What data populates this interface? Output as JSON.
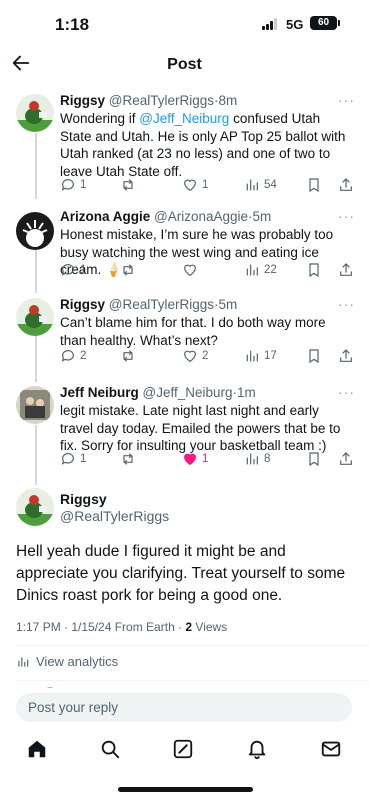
{
  "status_bar": {
    "time": "1:18",
    "network": "5G",
    "battery": "60"
  },
  "header": {
    "title": "Post"
  },
  "tweets": [
    {
      "name": "Riggsy",
      "handle": "@RealTylerRiggs",
      "time": "8m",
      "text_before": "Wondering if ",
      "mention": "@Jeff_Neiburg",
      "text_after": " confused Utah State and Utah. He is only AP Top 25 ballot with Utah ranked (at 23 no less) and one of two to leave Utah State off.",
      "replies": "1",
      "retweets": "",
      "likes": "1",
      "views": "54",
      "liked": false
    },
    {
      "name": "Arizona Aggie",
      "handle": "@ArizonaAggie",
      "time": "5m",
      "text": "Honest mistake, I’m sure he was probably too busy watching the west wing and eating ice cream. 🍦",
      "replies": "1",
      "retweets": "",
      "likes": "",
      "views": "22",
      "liked": false
    },
    {
      "name": "Riggsy",
      "handle": "@RealTylerRiggs",
      "time": "5m",
      "text": "Can’t blame him for that. I do both way more than healthy. What’s next?",
      "replies": "2",
      "retweets": "",
      "likes": "2",
      "views": "17",
      "liked": false
    },
    {
      "name": "Jeff Neiburg",
      "handle": "@Jeff_Neiburg",
      "time": "1m",
      "text": "legit mistake. Late night last night and early travel day today. Emailed the powers that be to fix. Sorry for insulting your basketball team :)",
      "replies": "1",
      "retweets": "",
      "likes": "1",
      "views": "8",
      "liked": true
    }
  ],
  "main_tweet": {
    "name": "Riggsy",
    "handle": "@RealTylerRiggs",
    "text": "Hell yeah dude I figured it might be and appreciate you clarifying. Treat yourself to some Dinics roast pork for being a good one.",
    "meta_time": "1:17 PM · 1/15/24 From Earth · ",
    "meta_views_count": "2",
    "meta_views_label": " Views",
    "analytics_label": "View analytics"
  },
  "reply_bar": {
    "placeholder": "Post your reply"
  },
  "colors": {
    "accent": "#1d9bf0",
    "like": "#f91880",
    "text": "#0f1419",
    "secondary": "#536471"
  },
  "icons": {
    "back": "arrow-left-icon",
    "nav": [
      "home-icon",
      "search-icon",
      "compose-icon",
      "bell-icon",
      "mail-icon"
    ]
  }
}
